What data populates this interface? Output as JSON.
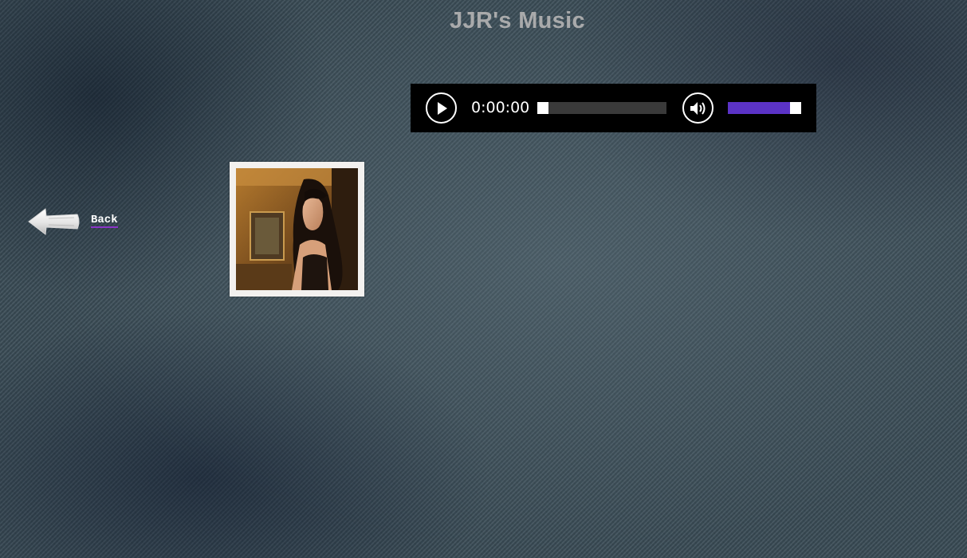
{
  "page": {
    "title": "JJR's Music",
    "background_color": "#3c4e58"
  },
  "player": {
    "current_time": "0:00:00",
    "progress_fraction": 0.0,
    "volume_fraction": 1.0,
    "play_icon": "play-icon",
    "volume_icon": "volume-icon",
    "accent_color": "#5b33c6"
  },
  "nav": {
    "back_label": "Back",
    "back_icon": "arrow-left-icon"
  },
  "album": {
    "image": "album-cover-image"
  }
}
